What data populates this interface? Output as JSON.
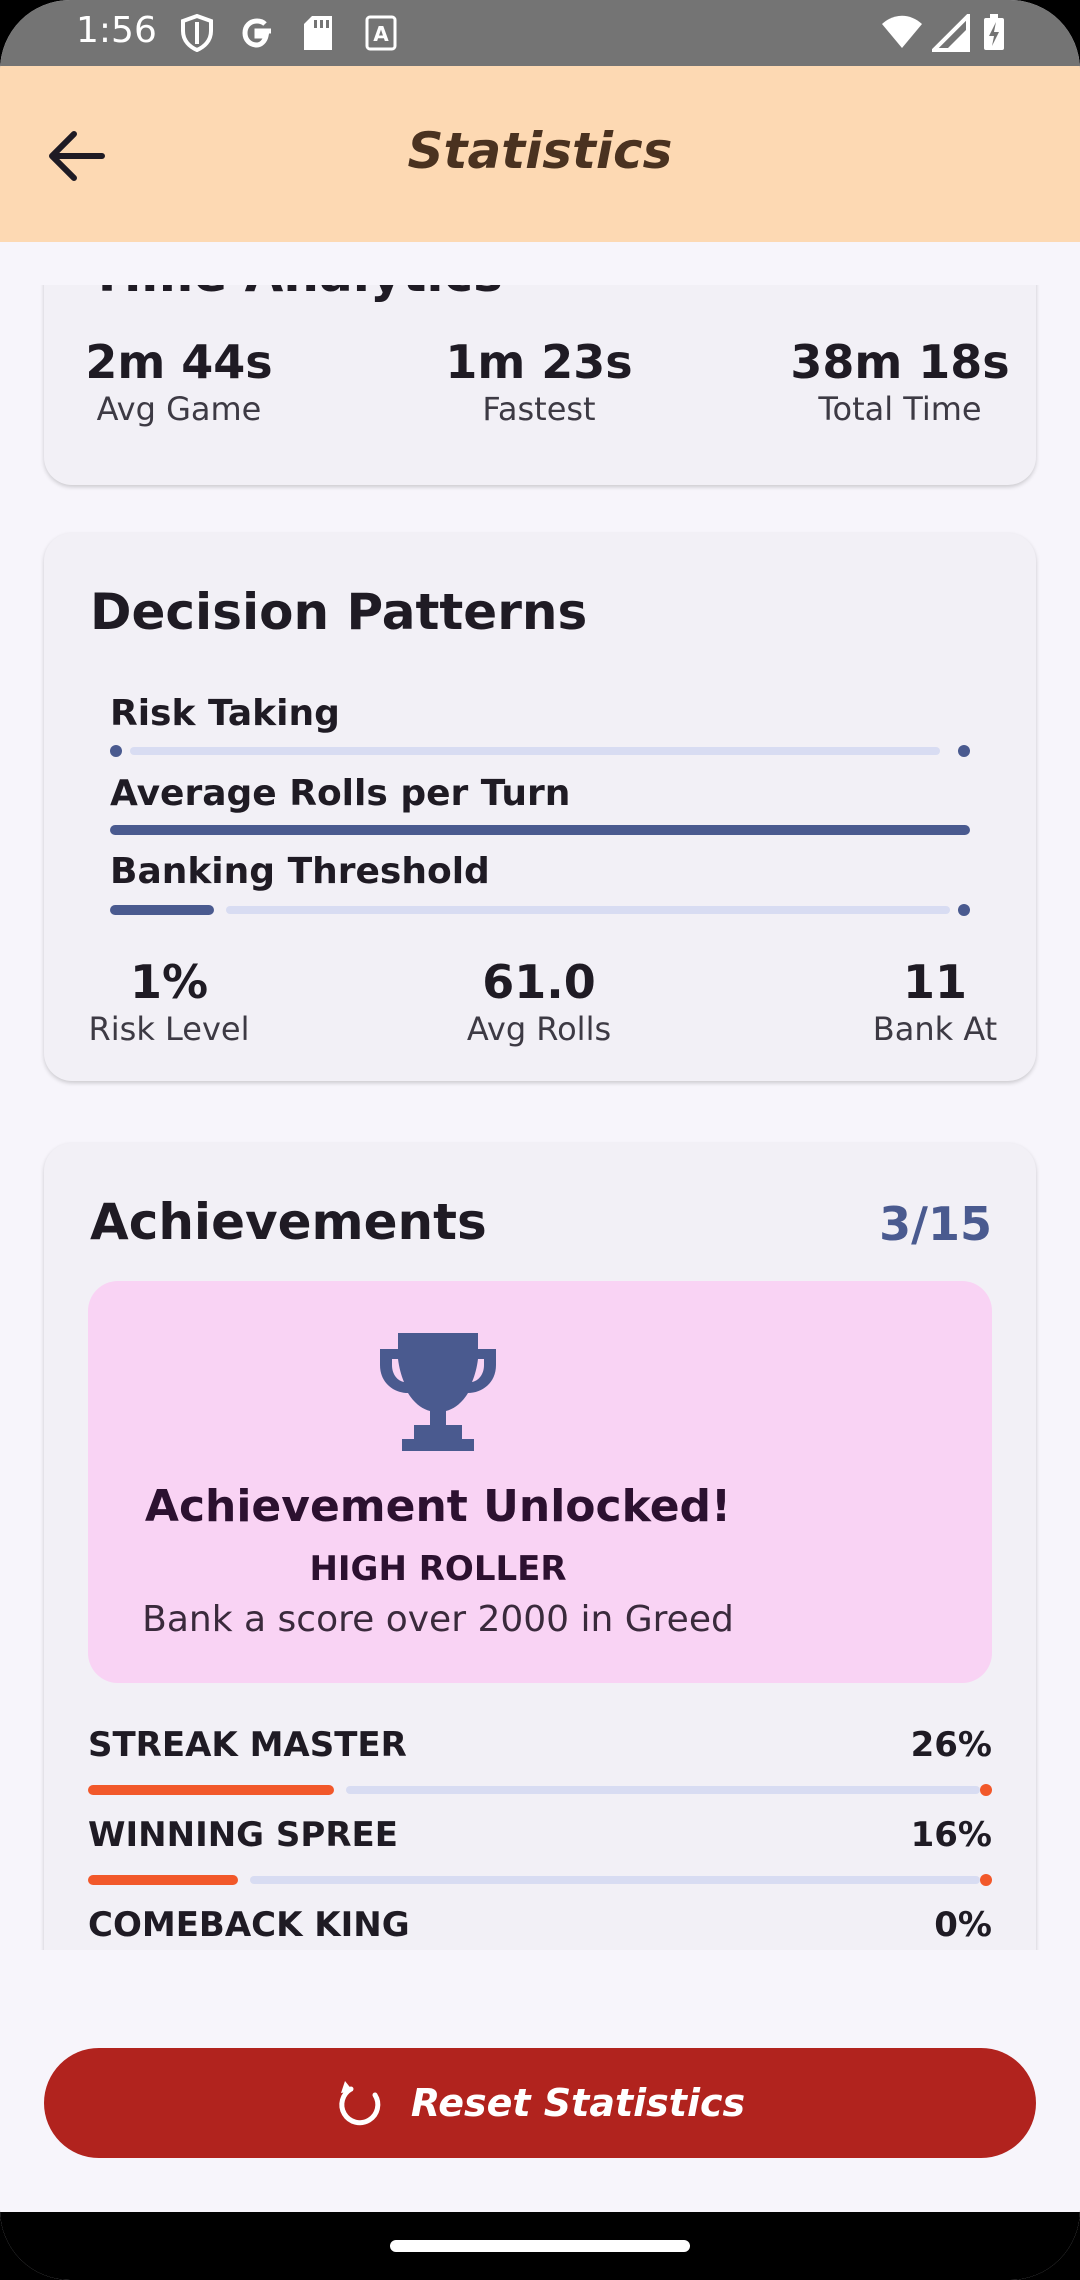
{
  "status_bar": {
    "time": "1:56",
    "icons_left": [
      "shield-icon",
      "google-icon",
      "sd-card-icon",
      "a-font-icon"
    ],
    "icons_right": [
      "wifi-icon",
      "signal-icon",
      "battery-charging-icon"
    ]
  },
  "app_bar": {
    "title": "Statistics",
    "back_icon": "arrow-left-icon"
  },
  "time_analytics": {
    "heading": "Time Analytics",
    "stats": [
      {
        "value": "2m 44s",
        "label": "Avg Game"
      },
      {
        "value": "1m 23s",
        "label": "Fastest"
      },
      {
        "value": "38m 18s",
        "label": "Total Time"
      }
    ]
  },
  "decision_patterns": {
    "heading": "Decision Patterns",
    "patterns": [
      {
        "label": "Risk Taking",
        "fraction": 0.01
      },
      {
        "label": "Average Rolls per Turn",
        "fraction": 1.0
      },
      {
        "label": "Banking Threshold",
        "fraction": 0.12
      }
    ],
    "stats": [
      {
        "value": "1%",
        "label": "Risk Level"
      },
      {
        "value": "61.0",
        "label": "Avg Rolls"
      },
      {
        "value": "11",
        "label": "Bank At"
      }
    ]
  },
  "achievements": {
    "heading": "Achievements",
    "count": "3/15",
    "unlocked": {
      "title": "Achievement Unlocked!",
      "name": "HIGH ROLLER",
      "description": "Bank a score over 2000 in Greed",
      "icon": "trophy-icon"
    },
    "progress": [
      {
        "label": "STREAK MASTER",
        "percent": "26%",
        "fraction": 0.26
      },
      {
        "label": "WINNING SPREE",
        "percent": "16%",
        "fraction": 0.16
      },
      {
        "label": "COMEBACK KING",
        "percent": "0%",
        "fraction": 0.0
      }
    ]
  },
  "reset_button": {
    "label": "Reset Statistics",
    "icon": "refresh-icon"
  },
  "colors": {
    "app_bar": "#fdd9b3",
    "accent_blue": "#4a5a8f",
    "progress_orange": "#f2582a",
    "reset_red": "#b1231e",
    "unlock_pink": "#f9d3f4"
  }
}
